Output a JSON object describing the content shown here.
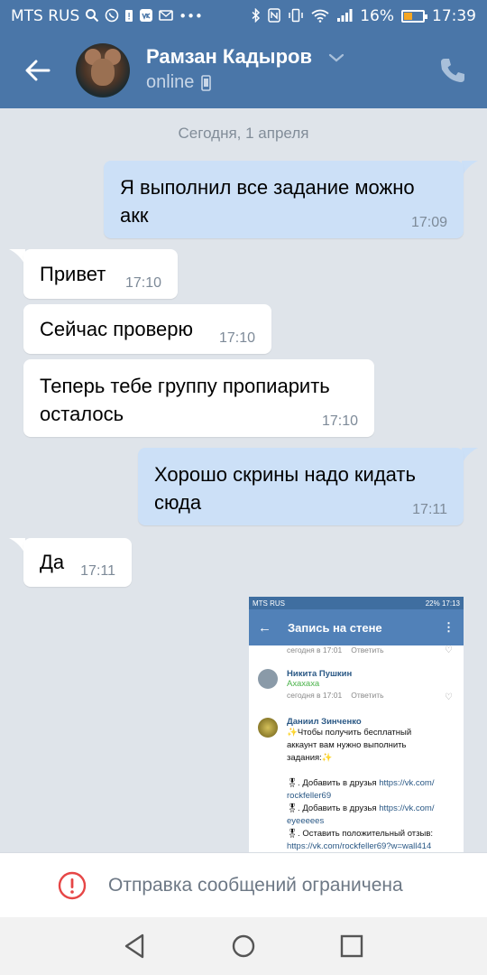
{
  "status_bar": {
    "carrier": "MTS RUS",
    "battery_percent": "16%",
    "battery_level": 0.16,
    "time": "17:39"
  },
  "header": {
    "contact_name": "Рамзан Кадыров",
    "status": "online"
  },
  "chat": {
    "date_divider": "Сегодня, 1 апреля",
    "messages": [
      {
        "direction": "out",
        "text": "Я выполнил все задание можно акк",
        "time": "17:09"
      },
      {
        "direction": "in",
        "text": "Привет",
        "time": "17:10"
      },
      {
        "direction": "in",
        "text": "Сейчас проверю",
        "time": "17:10"
      },
      {
        "direction": "in",
        "text": "Теперь тебе группу пропиарить осталось",
        "time": "17:10"
      },
      {
        "direction": "out",
        "text": "Хорошо скрины надо кидать сюда",
        "time": "17:11"
      },
      {
        "direction": "in",
        "text": "Да",
        "time": "17:11"
      }
    ]
  },
  "attachment": {
    "status_carrier": "MTS RUS",
    "status_right": "22% 17:13",
    "title": "Запись на стене",
    "top_meta_date": "сегодня в 17:01",
    "top_meta_reply": "Ответить",
    "comments": [
      {
        "author": "Никита Пушкин",
        "text": "Ахахаха",
        "date": "сегодня в 17:01",
        "reply": "Ответить"
      },
      {
        "author": "Даниил Зинченко",
        "line1": "✨Чтобы получить бесплатный",
        "line2": "аккаунт вам нужно выполнить",
        "line3": "задания:✨",
        "item1_prefix": "🎖. Добавить в друзья ",
        "item1_link": "https://vk.com/",
        "item1_link2": "rockfeller69",
        "item2_prefix": "🎖. Добавить в друзья ",
        "item2_link": "https://vk.com/",
        "item2_link2": "eyeeeees",
        "item3_prefix": "🎖. Оставить положительный отзыв:",
        "item3_link": "https://vk.com/rockfeller69?w=wall414"
      }
    ]
  },
  "restriction": {
    "text": "Отправка сообщений ограничена"
  },
  "colors": {
    "header": "#4a76a8",
    "outgoing_bubble": "#cce0f7",
    "incoming_bubble": "#ffffff",
    "background": "#dfe4ea",
    "warning": "#e64646"
  }
}
